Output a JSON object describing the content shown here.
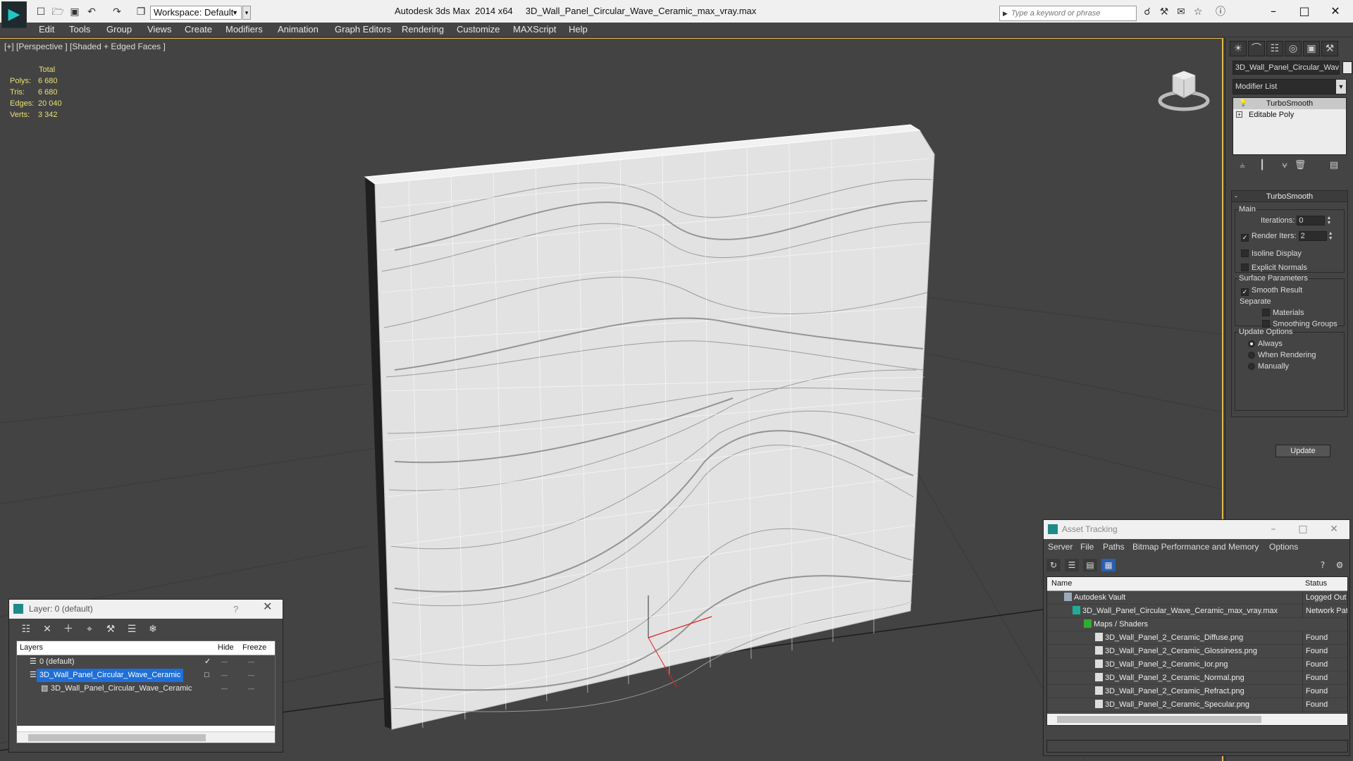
{
  "titlebar": {
    "app_name": "Autodesk 3ds Max  2014 x64",
    "file_name": "3D_Wall_Panel_Circular_Wave_Ceramic_max_vray.max",
    "workspace": "Workspace: Default",
    "search_placeholder": "Type a keyword or phrase",
    "icons": [
      "new-icon",
      "open-icon",
      "save-icon",
      "undo-icon",
      "redo-icon",
      "project-icon"
    ]
  },
  "menu": [
    "Edit",
    "Tools",
    "Group",
    "Views",
    "Create",
    "Modifiers",
    "Animation",
    "Graph Editors",
    "Rendering",
    "Customize",
    "MAXScript",
    "Help"
  ],
  "viewport": {
    "label": "[+] [Perspective ] [Shaded + Edged Faces ]",
    "stats": {
      "header": "Total",
      "rows": [
        {
          "label": "Polys:",
          "value": "6 680"
        },
        {
          "label": "Tris:",
          "value": "6 680"
        },
        {
          "label": "Edges:",
          "value": "20 040"
        },
        {
          "label": "Verts:",
          "value": "3 342"
        }
      ]
    },
    "accent_color": "#e0b84a"
  },
  "command_panel": {
    "object_name": "3D_Wall_Panel_Circular_Wav",
    "modifier_list": "Modifier List",
    "stack": [
      "TurboSmooth",
      "Editable Poly"
    ],
    "turbosmooth": {
      "title": "TurboSmooth",
      "main_label": "Main",
      "iterations_label": "Iterations:",
      "iterations": "0",
      "render_iters_label": "Render Iters:",
      "render_iters": "2",
      "render_iters_checked": true,
      "isoline_display": "Isoline Display",
      "explicit_normals": "Explicit Normals",
      "surface_params": "Surface Parameters",
      "smooth_result": "Smooth Result",
      "smooth_result_checked": true,
      "separate": "Separate",
      "materials": "Materials",
      "smoothing_groups": "Smoothing Groups",
      "update_options": "Update Options",
      "always": "Always",
      "when_rendering": "When Rendering",
      "manually": "Manually",
      "selected_update": "Always",
      "update_button": "Update"
    }
  },
  "layer_window": {
    "title": "Layer: 0 (default)",
    "help": "?",
    "col_layers": "Layers",
    "col_hide": "Hide",
    "col_freeze": "Freeze",
    "rows": [
      {
        "name": "0 (default)",
        "active": true
      },
      {
        "name": "3D_Wall_Panel_Circular_Wave_Ceramic",
        "selected": true
      },
      {
        "name": "3D_Wall_Panel_Circular_Wave_Ceramic",
        "child": true
      }
    ]
  },
  "asset_tracking": {
    "title": "Asset Tracking",
    "menu": [
      "Server",
      "File",
      "Paths",
      "Bitmap Performance and Memory",
      "Options"
    ],
    "col_name": "Name",
    "col_status": "Status",
    "rows": [
      {
        "name": "Autodesk Vault",
        "status": "Logged Out",
        "indent": 1,
        "icon": "vault"
      },
      {
        "name": "3D_Wall_Panel_Circular_Wave_Ceramic_max_vray.max",
        "status": "Network Pat",
        "indent": 2,
        "icon": "max"
      },
      {
        "name": "Maps / Shaders",
        "status": "",
        "indent": 3,
        "icon": "maps"
      },
      {
        "name": "3D_Wall_Panel_2_Ceramic_Diffuse.png",
        "status": "Found",
        "indent": 4,
        "icon": "file"
      },
      {
        "name": "3D_Wall_Panel_2_Ceramic_Glossiness.png",
        "status": "Found",
        "indent": 4,
        "icon": "file"
      },
      {
        "name": "3D_Wall_Panel_2_Ceramic_Ior.png",
        "status": "Found",
        "indent": 4,
        "icon": "file"
      },
      {
        "name": "3D_Wall_Panel_2_Ceramic_Normal.png",
        "status": "Found",
        "indent": 4,
        "icon": "file"
      },
      {
        "name": "3D_Wall_Panel_2_Ceramic_Refract.png",
        "status": "Found",
        "indent": 4,
        "icon": "file"
      },
      {
        "name": "3D_Wall_Panel_2_Ceramic_Specular.png",
        "status": "Found",
        "indent": 4,
        "icon": "file"
      }
    ]
  }
}
